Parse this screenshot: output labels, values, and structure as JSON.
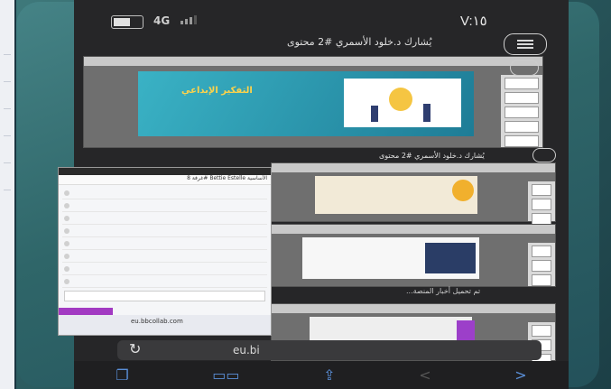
{
  "status_bar": {
    "time": "V:١٥",
    "network": "4G"
  },
  "top_bar": {
    "title": "يُشارك د.خلود الأسمري #2 محتوى"
  },
  "main_slide": {
    "title": "التفكير الإبداعي"
  },
  "second_caption": "يُشارك د.خلود الأسمري #2 محتوى",
  "third_caption": "تم تحميل أخبار المنصة...",
  "browser": {
    "url": "eu.bi",
    "inner_url": "eu.bbcollab.com"
  },
  "inner_phone": {
    "header": "غرفة 8# Bettie Estelle الأساسية"
  },
  "bottom_nav": [
    "tabs-icon",
    "bookmarks-icon",
    "share-icon",
    "back-icon",
    "forward-icon"
  ]
}
